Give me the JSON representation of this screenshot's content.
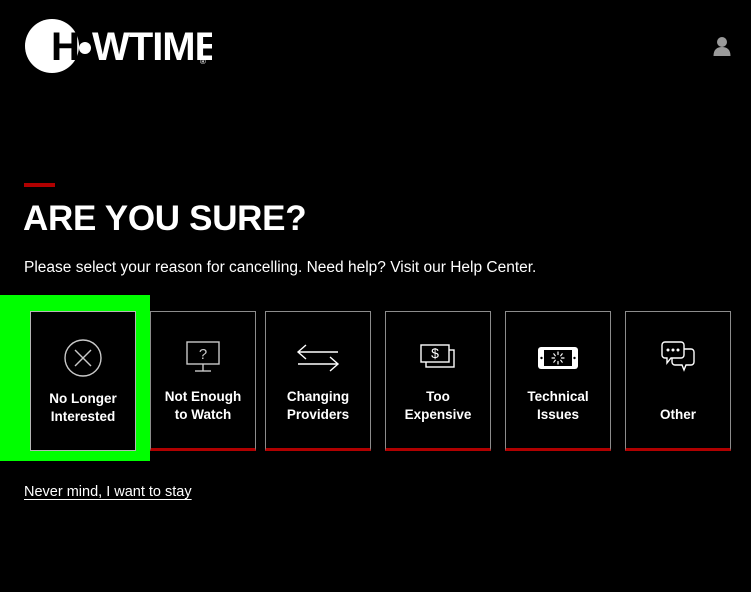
{
  "header": {
    "logo_text": "SHOWTIME",
    "logo_mark": "showtime-logo",
    "registered_mark": "®",
    "account_icon": "user-account-icon"
  },
  "main": {
    "accent_color": "#b00000",
    "title": "ARE YOU SURE?",
    "subtitle": "Please select your reason for cancelling. Need help? Visit our Help Center.",
    "stay_link": "Never mind, I want to stay"
  },
  "selection": {
    "highlight_color": "#00ff00",
    "selected_index": 0
  },
  "cards": [
    {
      "label_line1": "No Longer",
      "label_line2": "Interested",
      "icon": "circle-x-icon",
      "selected": true
    },
    {
      "label_line1": "Not Enough",
      "label_line2": "to Watch",
      "icon": "monitor-question-icon",
      "selected": false
    },
    {
      "label_line1": "Changing",
      "label_line2": "Providers",
      "icon": "exchange-arrows-icon",
      "selected": false
    },
    {
      "label_line1": "Too",
      "label_line2": "Expensive",
      "icon": "money-dollar-icon",
      "selected": false
    },
    {
      "label_line1": "Technical",
      "label_line2": "Issues",
      "icon": "device-loading-icon",
      "selected": false
    },
    {
      "label_line1": "Other",
      "label_line2": "",
      "icon": "chat-bubbles-icon",
      "selected": false
    }
  ]
}
